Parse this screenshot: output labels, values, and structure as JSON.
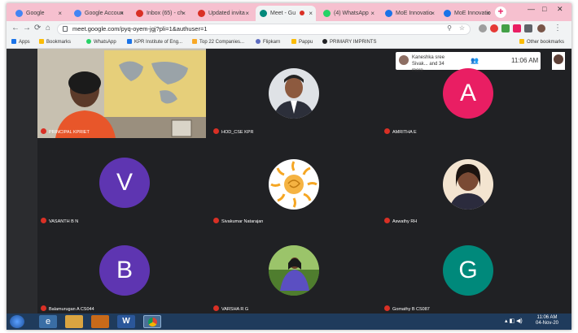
{
  "browser": {
    "tabs": [
      {
        "label": "Google",
        "fav": "#4285f4"
      },
      {
        "label": "Google Accoun",
        "fav": "#4285f4"
      },
      {
        "label": "Inbox (65) - ch",
        "fav": "#d93025"
      },
      {
        "label": "Updated invita",
        "fav": "#d93025"
      },
      {
        "label": "Meet - Gu",
        "fav": "#00897b"
      },
      {
        "label": "(4) WhatsApp",
        "fav": "#25d366"
      },
      {
        "label": "MoE Innovatio",
        "fav": "#1a73e8"
      },
      {
        "label": "MoE Innovatio",
        "fav": "#1a73e8"
      }
    ],
    "new_tab": "+",
    "url": "meet.google.com/pyq-oyem-jgj?pli=1&authuser=1",
    "bookmarks": [
      {
        "label": "Apps",
        "color": "#1a73e8"
      },
      {
        "label": "Bookmarks",
        "color": "#fbbc05"
      },
      {
        "label": "WhatsApp",
        "color": "#25d366"
      },
      {
        "label": "KPR Institute of Eng...",
        "color": "#1a73e8"
      },
      {
        "label": "Top 22 Companies...",
        "color": "#f9a825"
      },
      {
        "label": "Flipkarn",
        "color": "#5c6bc0"
      },
      {
        "label": "Pappu",
        "color": "#fbbc05"
      },
      {
        "label": "PRIMARY IMPRINTS",
        "color": "#202124"
      }
    ],
    "other_bookmarks": "Other bookmarks"
  },
  "meet": {
    "overlay": {
      "text": "Kaneshka sree Sivak... and 34 more",
      "time": "11:06 AM",
      "people_icon": "people-icon"
    },
    "tiles": [
      {
        "name": "PRINCIPAL KPRIET",
        "type": "video"
      },
      {
        "name": "HOD_CSE KPR",
        "type": "photo",
        "color": "#dfe2e6"
      },
      {
        "name": "AMRITHA E",
        "type": "letter",
        "letter": "A",
        "color": "#e91e63"
      },
      {
        "name": "VASANTH B N",
        "type": "letter",
        "letter": "V",
        "color": "#5e35b1"
      },
      {
        "name": "Sivakumar Natarajan",
        "type": "photo",
        "color": "#f5b342"
      },
      {
        "name": "Aswathy RH",
        "type": "photo",
        "color": "#f3e4d0"
      },
      {
        "name": "Balamurugan A CS044",
        "type": "letter",
        "letter": "B",
        "color": "#5e35b1"
      },
      {
        "name": "VARSHA R G",
        "type": "photo",
        "color": "#5a8c3a"
      },
      {
        "name": "Gomathy B CS087",
        "type": "letter",
        "letter": "G",
        "color": "#00897b"
      }
    ]
  },
  "taskbar": {
    "time": "11:06 AM",
    "date": "04-Nov-20"
  }
}
